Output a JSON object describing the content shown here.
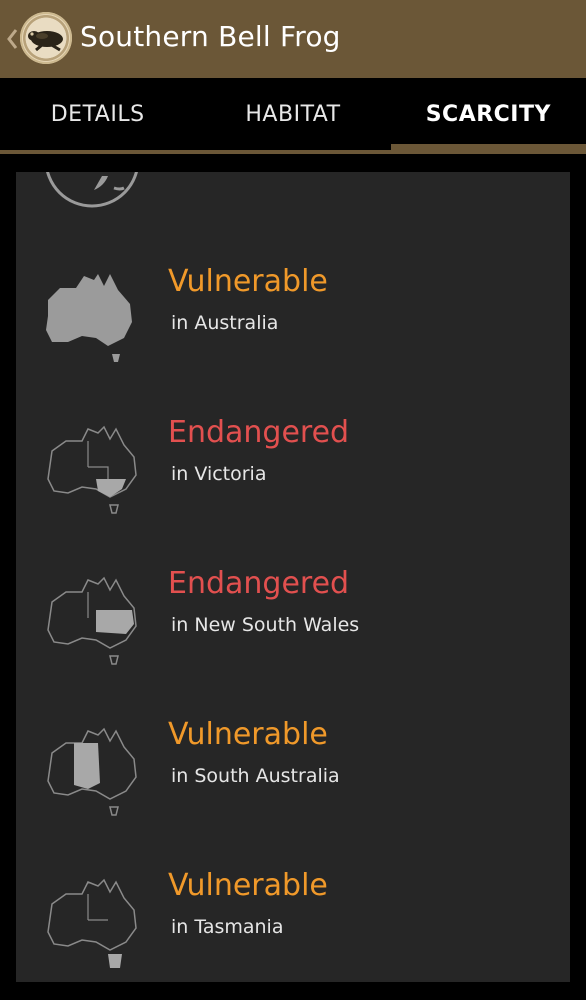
{
  "header": {
    "title": "Southern Bell Frog",
    "icon": "frog-icon"
  },
  "tabs": [
    {
      "label": "DETAILS",
      "active": false
    },
    {
      "label": "HABITAT",
      "active": false
    },
    {
      "label": "SCARCITY",
      "active": true
    }
  ],
  "scarcity": [
    {
      "status": "Vulnerable",
      "region": "in Australia",
      "color": "#f0992a",
      "map_icon": "australia-map-icon"
    },
    {
      "status": "Endangered",
      "region": "in Victoria",
      "color": "#e2504f",
      "map_icon": "victoria-map-icon"
    },
    {
      "status": "Endangered",
      "region": "in New South Wales",
      "color": "#e2504f",
      "map_icon": "nsw-map-icon"
    },
    {
      "status": "Vulnerable",
      "region": "in South Australia",
      "color": "#f0992a",
      "map_icon": "south-australia-map-icon"
    },
    {
      "status": "Vulnerable",
      "region": "in Tasmania",
      "color": "#f0992a",
      "map_icon": "tasmania-map-icon"
    }
  ],
  "colors": {
    "actionbar": "#6b5737",
    "vulnerable": "#f0992a",
    "endangered": "#e2504f",
    "panel": "#262626"
  }
}
